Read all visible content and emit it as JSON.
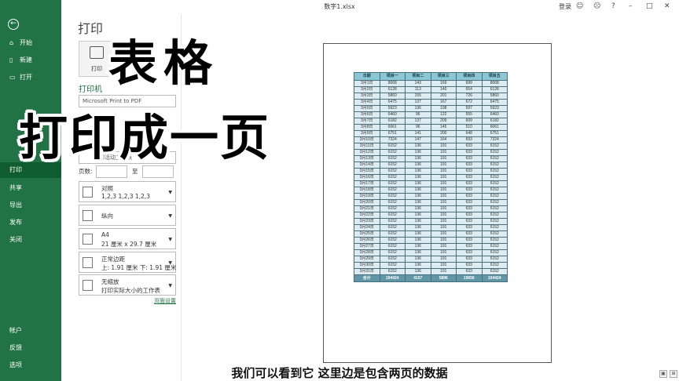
{
  "window": {
    "doc_title": "数字1.xlsx",
    "login": "登录"
  },
  "sidebar": {
    "items": [
      {
        "label": "开始",
        "icon": "home-icon"
      },
      {
        "label": "新建",
        "icon": "new-file-icon"
      },
      {
        "label": "打开",
        "icon": "folder-icon"
      },
      {
        "label": "打印",
        "icon": "print-icon"
      },
      {
        "label": "共享",
        "icon": "share-icon"
      },
      {
        "label": "导出",
        "icon": "export-icon"
      },
      {
        "label": "发布",
        "icon": "publish-icon"
      },
      {
        "label": "关闭",
        "icon": "close-icon"
      },
      {
        "label": "帐户",
        "icon": "account-icon"
      },
      {
        "label": "反馈",
        "icon": "feedback-icon"
      },
      {
        "label": "选项",
        "icon": "options-icon"
      }
    ],
    "active": "打印"
  },
  "print_panel": {
    "title": "打印",
    "print_button": "打印",
    "printer_label": "打印机",
    "printer_name": "Microsoft Print to PDF",
    "active_sheets": "打印活动工作表",
    "pages_label": "页数:",
    "to_label": "至",
    "collate": {
      "t1": "对照",
      "t2": "1,2,3    1,2,3    1,2,3"
    },
    "orientation": {
      "t1": "纵向",
      "t2": ""
    },
    "paper": {
      "t1": "A4",
      "t2": "21 厘米 x 29.7 厘米"
    },
    "margins": {
      "t1": "正常边距",
      "t2": "上: 1.91 厘米 下: 1.91 厘米"
    },
    "scaling": {
      "t1": "无缩放",
      "t2": "打印实际大小的工作表"
    },
    "page_setup_link": "页面设置"
  },
  "overlay": {
    "line1": "表格",
    "line2": "打印成一页",
    "subtitle": "我们可以看到它 这里边是包含两页的数据"
  },
  "sheet": {
    "headers": [
      "日期",
      "项目一",
      "项目二",
      "项目三",
      "项目四",
      "项目五"
    ],
    "rows": [
      [
        "3月1日",
        "8068",
        "143",
        "169",
        "699",
        "8068"
      ],
      [
        "3月2日",
        "6128",
        "113",
        "140",
        "654",
        "6128"
      ],
      [
        "3月3日",
        "5860",
        "155",
        "201",
        "726",
        "5860"
      ],
      [
        "3月4日",
        "6475",
        "137",
        "167",
        "672",
        "6475"
      ],
      [
        "3月5日",
        "5923",
        "136",
        "198",
        "597",
        "5923"
      ],
      [
        "3月6日",
        "6460",
        "96",
        "122",
        "555",
        "6460"
      ],
      [
        "3月7日",
        "6182",
        "137",
        "209",
        "609",
        "6182"
      ],
      [
        "3月8日",
        "6061",
        "96",
        "145",
        "510",
        "6061"
      ],
      [
        "3月9日",
        "6751",
        "141",
        "200",
        "648",
        "6751"
      ],
      [
        "3月10日",
        "7324",
        "147",
        "164",
        "693",
        "7324"
      ],
      [
        "3月11日",
        "6152",
        "136",
        "191",
        "633",
        "6152"
      ],
      [
        "3月12日",
        "6152",
        "136",
        "191",
        "633",
        "6152"
      ],
      [
        "3月13日",
        "6152",
        "136",
        "191",
        "633",
        "6152"
      ],
      [
        "3月14日",
        "6152",
        "136",
        "191",
        "633",
        "6152"
      ],
      [
        "3月15日",
        "6152",
        "136",
        "191",
        "633",
        "6152"
      ],
      [
        "3月16日",
        "6152",
        "136",
        "191",
        "633",
        "6152"
      ],
      [
        "3月17日",
        "6152",
        "136",
        "191",
        "633",
        "6152"
      ],
      [
        "3月18日",
        "6152",
        "136",
        "191",
        "633",
        "6152"
      ],
      [
        "3月19日",
        "6152",
        "136",
        "191",
        "633",
        "6152"
      ],
      [
        "3月20日",
        "6152",
        "136",
        "191",
        "633",
        "6152"
      ],
      [
        "3月21日",
        "6152",
        "136",
        "191",
        "633",
        "6152"
      ],
      [
        "3月22日",
        "6152",
        "136",
        "191",
        "633",
        "6152"
      ],
      [
        "3月23日",
        "6152",
        "136",
        "191",
        "633",
        "6152"
      ],
      [
        "3月24日",
        "6152",
        "136",
        "191",
        "633",
        "6152"
      ],
      [
        "3月25日",
        "6152",
        "136",
        "191",
        "633",
        "6152"
      ],
      [
        "3月26日",
        "6152",
        "136",
        "191",
        "633",
        "6152"
      ],
      [
        "3月27日",
        "6152",
        "136",
        "191",
        "633",
        "6152"
      ],
      [
        "3月28日",
        "6152",
        "136",
        "191",
        "633",
        "6152"
      ],
      [
        "3月29日",
        "6152",
        "136",
        "191",
        "633",
        "6152"
      ],
      [
        "3月30日",
        "6152",
        "136",
        "191",
        "633",
        "6152"
      ],
      [
        "3月31日",
        "6152",
        "136",
        "191",
        "633",
        "6152"
      ]
    ],
    "total": [
      "合计",
      "194424",
      "4157",
      "5896",
      "19656",
      "194424"
    ]
  },
  "colors": {
    "sidebar": "#217346",
    "header_fill": "#8cc7d6",
    "cell_fill": "#dcecf2",
    "total_fill": "#5f97a6"
  }
}
